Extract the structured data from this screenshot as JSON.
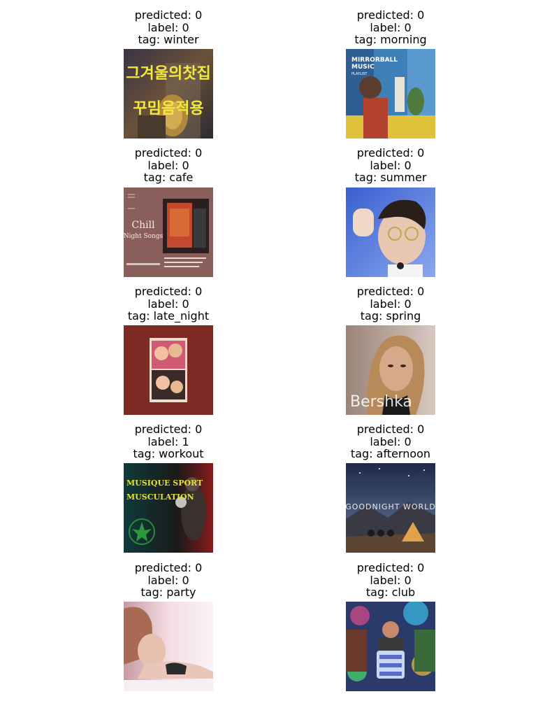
{
  "samples": [
    {
      "predicted": "predicted: 0",
      "label": "label: 0",
      "tag": "tag: winter",
      "thumb_text_1": "그겨울의찻집",
      "thumb_text_2": "꾸밈음적용"
    },
    {
      "predicted": "predicted: 0",
      "label": "label: 0",
      "tag": "tag: morning",
      "thumb_text_1": "MIRRORBALL",
      "thumb_text_2": "MUSIC",
      "thumb_text_3": "PLAYLIST"
    },
    {
      "predicted": "predicted: 0",
      "label": "label: 0",
      "tag": "tag: cafe",
      "thumb_text_1": "Chill",
      "thumb_text_2": "Night Songs"
    },
    {
      "predicted": "predicted: 0",
      "label": "label: 0",
      "tag": "tag: summer"
    },
    {
      "predicted": "predicted: 0",
      "label": "label: 0",
      "tag": "tag: late_night"
    },
    {
      "predicted": "predicted: 0",
      "label": "label: 0",
      "tag": "tag: spring",
      "thumb_text_1": "Bershka"
    },
    {
      "predicted": "predicted: 0",
      "label": "label: 1",
      "tag": "tag: workout",
      "thumb_text_1": "MUSIQUE SPORT",
      "thumb_text_2": "MUSCULATION"
    },
    {
      "predicted": "predicted: 0",
      "label": "label: 0",
      "tag": "tag: afternoon",
      "thumb_text_1": "GOODNIGHT WORLD"
    },
    {
      "predicted": "predicted: 0",
      "label": "label: 0",
      "tag": "tag: party"
    },
    {
      "predicted": "predicted: 0",
      "label": "label: 0",
      "tag": "tag: club"
    }
  ]
}
